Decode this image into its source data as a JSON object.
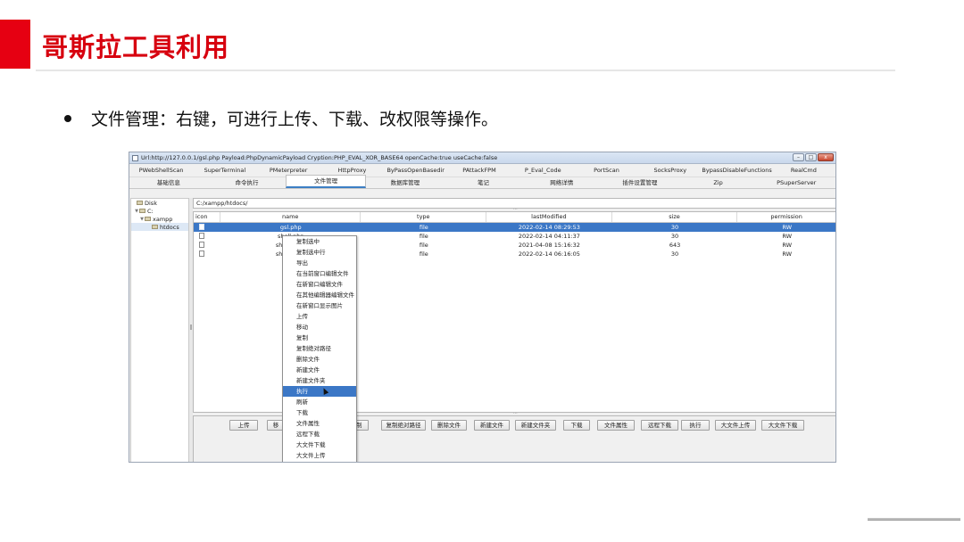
{
  "slide": {
    "title": "哥斯拉工具利用",
    "bullet": "文件管理：右键，可进行上传、下载、改权限等操作。"
  },
  "window": {
    "title": "Url:http://127.0.0.1/gsl.php Payload:PhpDynamicPayload Cryption:PHP_EVAL_XOR_BASE64 openCache:true useCache:false",
    "controls": [
      "–",
      "□",
      "x"
    ]
  },
  "plugin_tabs": [
    "PWebShellScan",
    "SuperTerminal",
    "PMeterpreter",
    "HttpProxy",
    "ByPassOpenBasedir",
    "PAttackFPM",
    "P_Eval_Code",
    "PortScan",
    "SocksProxy",
    "BypassDisableFunctions",
    "RealCmd"
  ],
  "sub_tabs": [
    "基础信息",
    "命令执行",
    "文件管理",
    "数据库管理",
    "笔记",
    "网络详情",
    "插件设置管理",
    "Zip",
    "PSuperServer"
  ],
  "active_sub_tab": "文件管理",
  "tree": [
    {
      "label": "Disk",
      "toggle": ""
    },
    {
      "label": "C:",
      "toggle": "▼"
    },
    {
      "label": "xampp",
      "toggle": "▼"
    },
    {
      "label": "htdocs",
      "toggle": ""
    }
  ],
  "path": "C:/xampp/htdocs/",
  "splitter": "···",
  "columns": [
    "icon",
    "name",
    "type",
    "lastModified",
    "size",
    "permission"
  ],
  "rows": [
    {
      "name": "gsl.php",
      "type": "file",
      "lastModified": "2022-02-14 08:29:53",
      "size": "30",
      "permission": "RW"
    },
    {
      "name": "shell.php",
      "type": "file",
      "lastModified": "2022-02-14 04:11:37",
      "size": "30",
      "permission": "RW"
    },
    {
      "name": "shellb.php",
      "type": "file",
      "lastModified": "2021-04-08 15:16:32",
      "size": "643",
      "permission": "RW"
    },
    {
      "name": "shellg.php",
      "type": "file",
      "lastModified": "2022-02-14 06:16:05",
      "size": "30",
      "permission": "RW"
    }
  ],
  "context_menu": [
    "复制选中",
    "复制选中行",
    "导出",
    "在当前窗口编辑文件",
    "在新窗口编辑文件",
    "在其他编辑器编辑文件",
    "在新窗口显示图片",
    "上传",
    "移动",
    "复制",
    "复制绝对路径",
    "删除文件",
    "新建文件",
    "新建文件夹",
    "执行",
    "刷新",
    "下载",
    "文件属性",
    "远程下载",
    "大文件下载",
    "大文件上传"
  ],
  "context_highlighted": "执行",
  "bottom_buttons": [
    "上传",
    "移",
    "复制",
    "复制绝对路径",
    "删除文件",
    "新建文件",
    "新建文件夹",
    "下载",
    "文件属性",
    "远程下载",
    "执行",
    "大文件上传",
    "大文件下载"
  ]
}
